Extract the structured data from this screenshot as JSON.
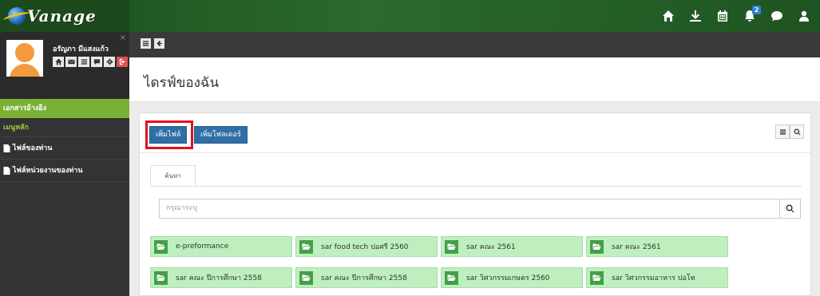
{
  "app": {
    "logo_text": "Vanage",
    "notification_count": "2"
  },
  "top_icons": [
    "home-icon",
    "download-icon",
    "calendar-icon",
    "bell-icon",
    "comment-icon",
    "user-icon"
  ],
  "sidebar": {
    "close_symbol": "×",
    "user_name": "อรัญภา มีแสงแก้ว",
    "menu_active": "เอกสารอ้างอิง",
    "menu_header": "เมนูหลัก",
    "items": [
      {
        "label": "ไฟล์ของท่าน"
      },
      {
        "label": "ไฟล์หน่วยงานของท่าน"
      }
    ]
  },
  "page": {
    "title": "ไดรฟ์ของฉัน"
  },
  "actions": {
    "add_file": "เพิ่มไฟล์",
    "add_folder": "เพิ่มโฟลเดอร์"
  },
  "tabs": {
    "search": "ค้นหา"
  },
  "search": {
    "placeholder": "กรุณาระบุ"
  },
  "folders": [
    {
      "name": "e-preformance"
    },
    {
      "name": "sar food tech ปอศรี 2560"
    },
    {
      "name": "sar คณะ 2561"
    },
    {
      "name": "sar คณะ 2561"
    },
    {
      "name": "sar คณะ ปีการศึกษา 2558"
    },
    {
      "name": "sar คณะ ปีการศึกษา 2558"
    },
    {
      "name": "sar วิศวกรรมเกษตร 2560"
    },
    {
      "name": "sar วิศวกรรมอาหาร ปอโท"
    }
  ],
  "colors": {
    "topbar": "#2b6a2d",
    "sidebar": "#333333",
    "menu_active": "#7bb035",
    "primary_button": "#2f6ea6",
    "folder_bg": "#bfefbf",
    "folder_icon": "#43a047",
    "highlight": "#e0121a"
  }
}
